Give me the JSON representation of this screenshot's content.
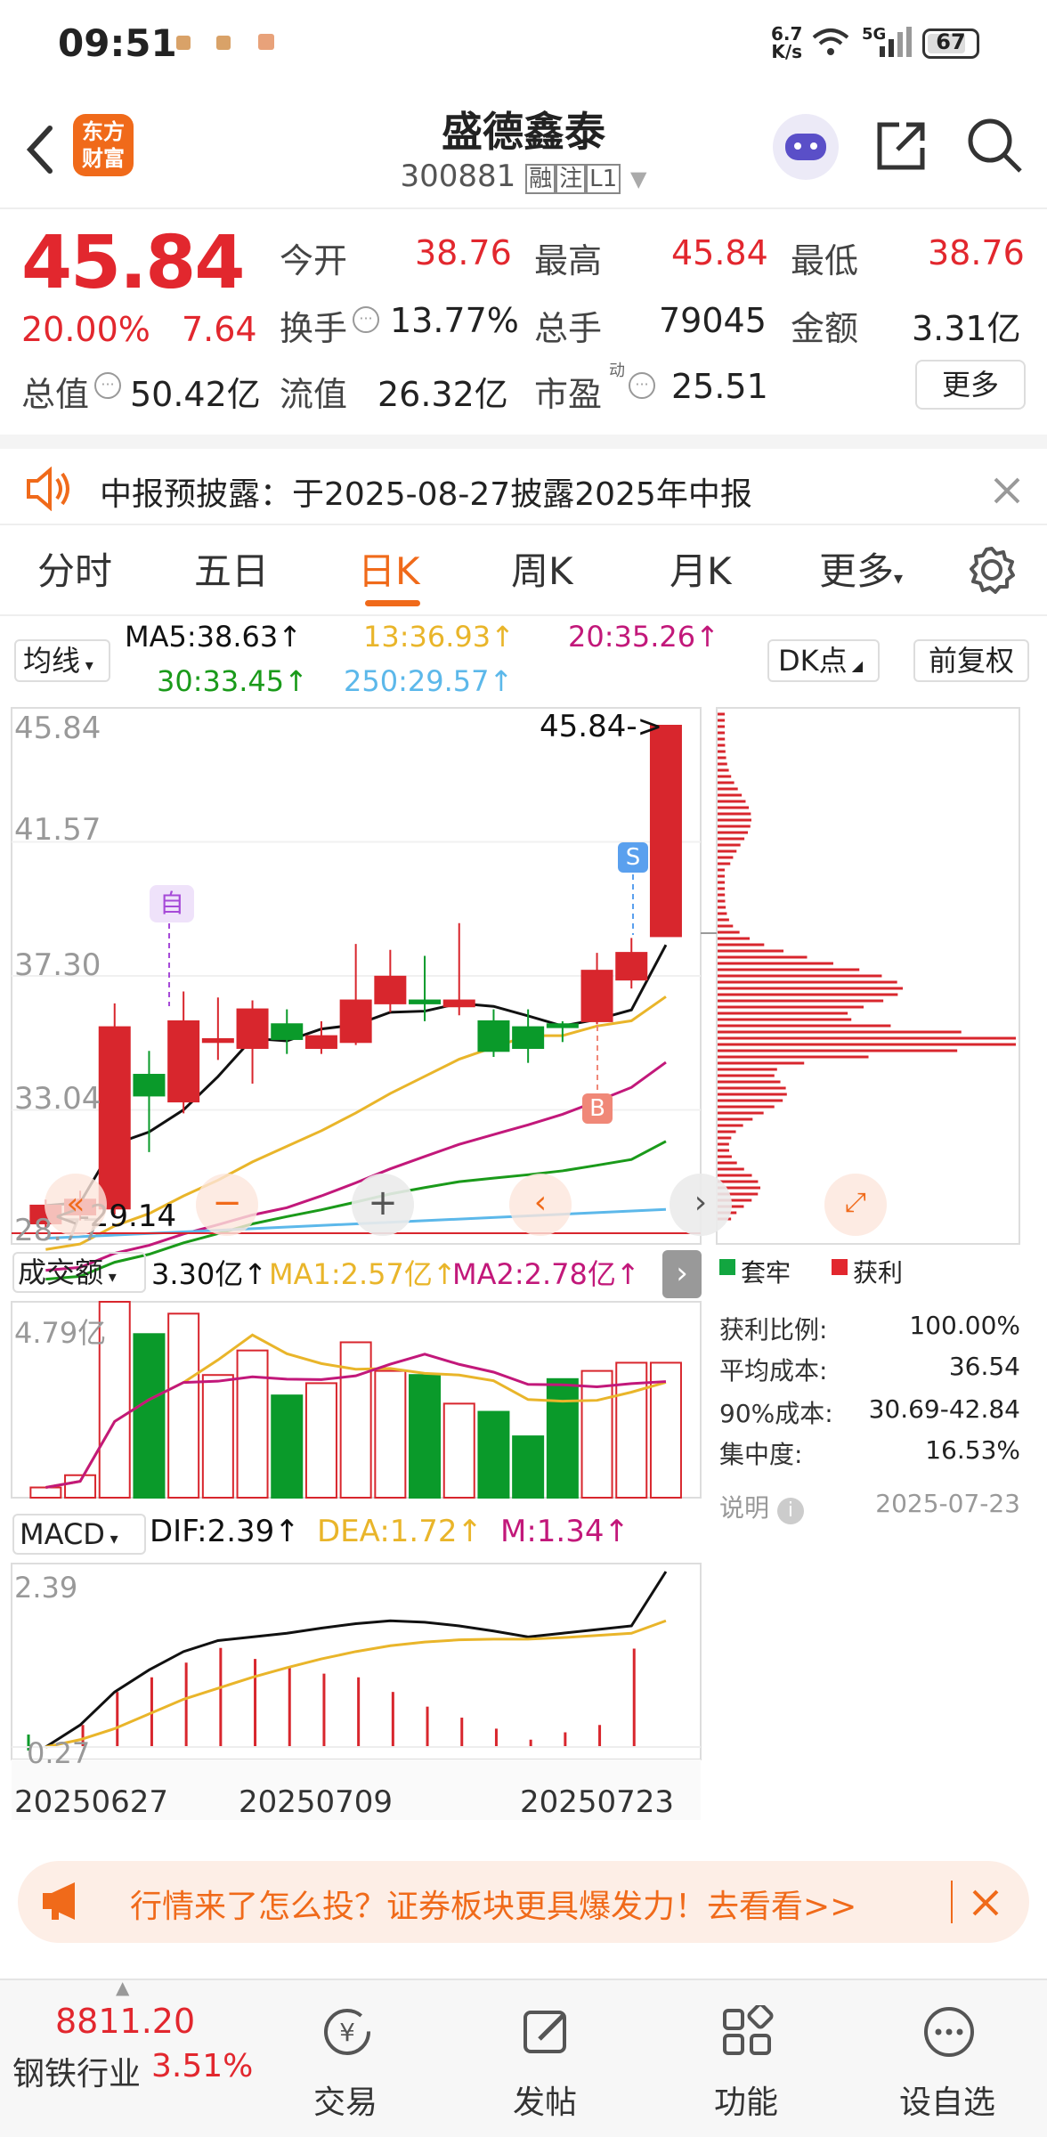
{
  "status_bar": {
    "time": "09:51",
    "net_speed_top": "6.7",
    "net_speed_bottom": "K/s",
    "signal": "5G",
    "battery": "67"
  },
  "header": {
    "logo_line1": "东方",
    "logo_line2": "财富",
    "title": "盛德鑫泰",
    "code": "300881",
    "tag1": "融",
    "tag2": "注",
    "tag3": "L1"
  },
  "quote": {
    "price": "45.84",
    "change_pct": "20.00%",
    "change_amt": "7.64",
    "open_label": "今开",
    "open": "38.76",
    "high_label": "最高",
    "high": "45.84",
    "low_label": "最低",
    "low": "38.76",
    "turnover_label": "换手",
    "turnover": "13.77%",
    "volume_label": "总手",
    "volume": "79045",
    "amount_label": "金额",
    "amount": "3.31亿",
    "mcap_label": "总值",
    "mcap": "50.42亿",
    "float_label": "流值",
    "float": "26.32亿",
    "pe_label": "市盈",
    "pe_sup": "动",
    "pe": "25.51",
    "more_button": "更多"
  },
  "notice": {
    "text": "中报预披露：于2025-08-27披露2025年中报"
  },
  "tabs": [
    "分时",
    "五日",
    "日K",
    "周K",
    "月K",
    "更多"
  ],
  "active_tab": "日K",
  "ma_legend": {
    "selector": "均线",
    "ma5": "MA5:38.63",
    "ma13": "13:36.93",
    "ma20": "20:35.26",
    "ma30": "30:33.45",
    "ma250": "250:29.57",
    "dk_button": "DK点",
    "adjust_button": "前复权",
    "colors": {
      "ma5": "#111111",
      "ma13": "#e9b52a",
      "ma20": "#c2187a",
      "ma30": "#1a9a1a",
      "ma250": "#5cb8ea"
    }
  },
  "kline": {
    "y_labels": [
      "45.84",
      "41.57",
      "37.30",
      "33.04",
      "28.77"
    ],
    "max_tag": "45.84->",
    "min_tag": "29.14",
    "marker_self": "自",
    "marker_s": "S",
    "marker_b": "B"
  },
  "volume_panel": {
    "selector": "成交额",
    "value": "3.30亿",
    "ma1": "MA1:2.57亿",
    "ma2": "MA2:2.78亿",
    "y_label": "4.79亿"
  },
  "macd_panel": {
    "selector": "MACD",
    "dif": "DIF:2.39",
    "dea": "DEA:1.72",
    "m": "M:1.34",
    "y_top": "2.39",
    "y_bottom": "0.27"
  },
  "x_dates": [
    "20250627",
    "20250709",
    "20250723"
  ],
  "chip": {
    "legend_trapped": "套牢",
    "legend_profit": "获利",
    "stats": [
      {
        "label": "获利比例:",
        "value": "100.00%"
      },
      {
        "label": "平均成本:",
        "value": "36.54"
      },
      {
        "label": "90%成本:",
        "value": "30.69-42.84"
      },
      {
        "label": "集中度:",
        "value": "16.53%"
      }
    ],
    "note_label": "说明",
    "date": "2025-07-23"
  },
  "banner": {
    "text": "行情来了怎么投？证券板块更具爆发力！去看看>>"
  },
  "bottom_nav": {
    "index_value": "8811.20",
    "index_name": "钢铁行业",
    "index_change": "3.51%",
    "items": [
      "交易",
      "发帖",
      "功能",
      "设自选"
    ]
  },
  "candles": [
    {
      "o": 29.1,
      "c": 29.7,
      "h": 29.9,
      "l": 28.9
    },
    {
      "o": 29.4,
      "c": 29.9,
      "h": 30.2,
      "l": 29.2
    },
    {
      "o": 29.6,
      "c": 35.7,
      "h": 36.5,
      "l": 29.4
    },
    {
      "o": 34.1,
      "c": 33.4,
      "h": 34.9,
      "l": 31.5
    },
    {
      "o": 33.2,
      "c": 35.9,
      "h": 36.9,
      "l": 32.8
    },
    {
      "o": 35.2,
      "c": 35.3,
      "h": 36.7,
      "l": 34.6
    },
    {
      "o": 35.0,
      "c": 36.3,
      "h": 36.6,
      "l": 33.8
    },
    {
      "o": 35.8,
      "c": 35.3,
      "h": 36.3,
      "l": 34.8
    },
    {
      "o": 35.0,
      "c": 35.4,
      "h": 35.9,
      "l": 34.8
    },
    {
      "o": 35.2,
      "c": 36.6,
      "h": 38.5,
      "l": 35.1
    },
    {
      "o": 36.5,
      "c": 37.4,
      "h": 38.3,
      "l": 36.2
    },
    {
      "o": 36.6,
      "c": 36.5,
      "h": 38.1,
      "l": 35.9
    },
    {
      "o": 36.4,
      "c": 36.6,
      "h": 39.2,
      "l": 36.1
    },
    {
      "o": 35.9,
      "c": 34.9,
      "h": 36.3,
      "l": 34.7
    },
    {
      "o": 35.7,
      "c": 35.0,
      "h": 36.3,
      "l": 34.5
    },
    {
      "o": 35.8,
      "c": 35.7,
      "h": 35.9,
      "l": 35.2
    },
    {
      "o": 35.9,
      "c": 37.6,
      "h": 38.2,
      "l": 35.8
    },
    {
      "o": 37.3,
      "c": 38.2,
      "h": 38.7,
      "l": 37.0
    },
    {
      "o": 38.76,
      "c": 45.84,
      "h": 45.84,
      "l": 38.76
    }
  ],
  "volumes": [
    0.25,
    0.55,
    4.79,
    4.0,
    4.5,
    3.0,
    3.6,
    2.5,
    2.8,
    3.8,
    3.1,
    3.0,
    2.3,
    2.1,
    1.5,
    2.9,
    3.1,
    3.3,
    3.3
  ],
  "macd_bars": [
    0.0,
    0.3,
    0.75,
    0.95,
    1.15,
    1.35,
    1.2,
    1.1,
    1.0,
    0.95,
    0.75,
    0.55,
    0.4,
    0.25,
    0.1,
    0.2,
    0.3,
    1.34
  ]
}
